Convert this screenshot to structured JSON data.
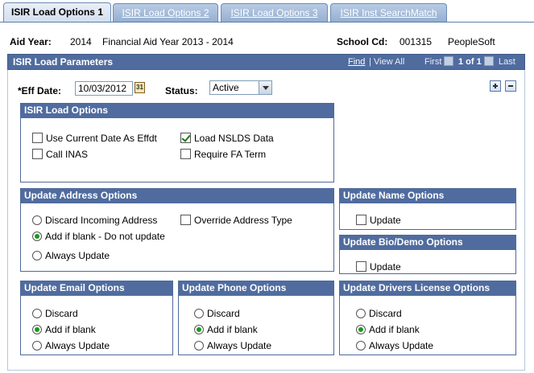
{
  "tabs": [
    {
      "label": "ISIR Load Options 1",
      "active": true
    },
    {
      "label": "ISIR Load Options 2",
      "active": false
    },
    {
      "label": "ISIR Load Options 3",
      "active": false
    },
    {
      "label": "ISIR Inst SearchMatch",
      "active": false
    }
  ],
  "header": {
    "aid_year_label": "Aid Year:",
    "aid_year_value": "2014",
    "aid_year_desc": "Financial Aid Year 2013 - 2014",
    "school_label": "School Cd:",
    "school_code": "001315",
    "school_name": "PeopleSoft"
  },
  "panel": {
    "title": "ISIR Load Parameters",
    "find": "Find",
    "separator": "|",
    "view_all": "View All",
    "first": "First",
    "page_info": "1 of 1",
    "last": "Last"
  },
  "eff_date": {
    "label": "*Eff Date:",
    "value": "10/03/2012",
    "cal_icon": "31"
  },
  "status": {
    "label": "Status:",
    "value": "Active"
  },
  "load_options": {
    "title": "ISIR Load Options",
    "use_current_date": "Use Current Date As Effdt",
    "load_nslds": "Load NSLDS Data",
    "call_inas": "Call INAS",
    "require_fa_term": "Require FA Term"
  },
  "address_options": {
    "title": "Update Address Options",
    "discard": "Discard Incoming Address",
    "add_if_blank": "Add if blank - Do not update",
    "always_update": "Always Update",
    "override_type": "Override Address Type"
  },
  "name_options": {
    "title": "Update Name Options",
    "update": "Update"
  },
  "bio_options": {
    "title": "Update Bio/Demo Options",
    "update": "Update"
  },
  "email_options": {
    "title": "Update Email Options",
    "discard": "Discard",
    "add_if_blank": "Add if blank",
    "always_update": "Always Update"
  },
  "phone_options": {
    "title": "Update Phone Options",
    "discard": "Discard",
    "add_if_blank": "Add if blank",
    "always_update": "Always Update"
  },
  "license_options": {
    "title": "Update Drivers License Options",
    "discard": "Discard",
    "add_if_blank": "Add if blank",
    "always_update": "Always Update"
  },
  "colors": {
    "header_blue": "#506c9f",
    "tab_active": "#e9eff8",
    "tab_inactive": "#94aed1",
    "check_green": "#1a7a1a"
  }
}
